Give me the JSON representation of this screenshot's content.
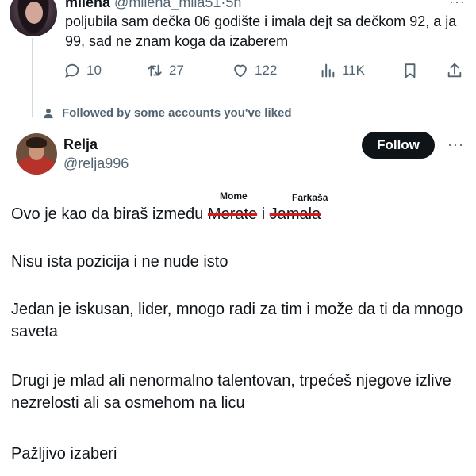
{
  "parent_tweet": {
    "display_name": "milena",
    "handle": "@milena_mila51",
    "separator": "·",
    "time": "5h",
    "text": "poljubila sam dečka 06 godište i imala dejt sa dečkom 92, a ja 99, sad ne znam koga da izaberem",
    "actions": {
      "replies": "10",
      "reposts": "27",
      "likes": "122",
      "views": "11K"
    }
  },
  "social_context": "Followed by some accounts you've liked",
  "reply": {
    "display_name": "Relja",
    "handle": "@relja996",
    "follow_label": "Follow",
    "line1": {
      "before": "Ovo je kao da biraš između ",
      "struck_1": "Morate",
      "middle": " i ",
      "struck_2": "Jamala",
      "note_1": "Mome",
      "note_2": "Farkaša"
    },
    "paragraphs": [
      "Nisu ista pozicija i ne nude isto",
      "Jedan je iskusan, lider, mnogo radi za tim i može da ti da mnogo saveta",
      "Drugi je mlad ali nenormalno talentovan, trpećeš njegove izlive nezrelosti ali sa osmehom na licu",
      "Pažljivo izaberi"
    ]
  },
  "colors": {
    "text": "#0f1419",
    "secondary": "#536471",
    "strike": "#d11d1d",
    "follow_bg": "#0f1419"
  }
}
